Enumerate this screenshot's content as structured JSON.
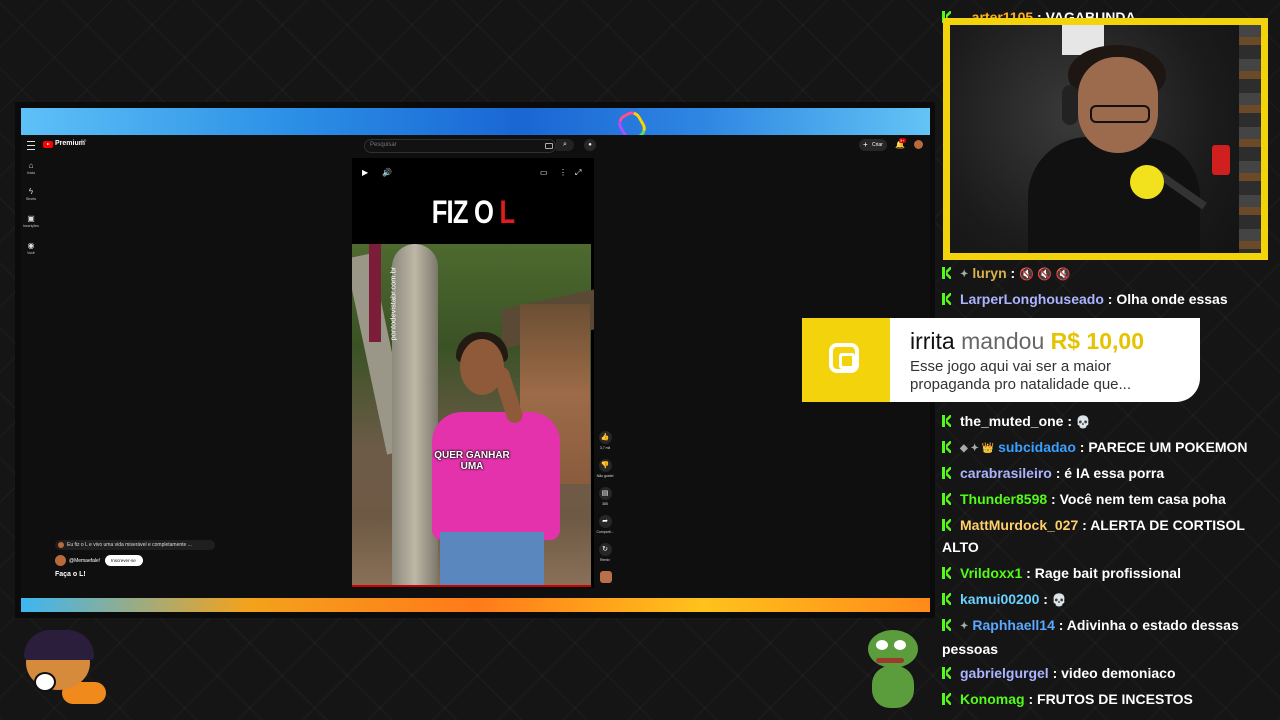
{
  "youtube": {
    "brand": "Premium",
    "country": "BR",
    "search_placeholder": "Pesquisar",
    "create_label": "Criar",
    "notification_count": "9+",
    "nav": [
      {
        "icon": "⌂",
        "label": "Início"
      },
      {
        "icon": "ϟ",
        "label": "Shorts"
      },
      {
        "icon": "▣",
        "label": "Inscrições"
      },
      {
        "icon": "◉",
        "label": "Você"
      }
    ],
    "short": {
      "headline_part1": "FIZ O ",
      "headline_part2": "L",
      "watermark": "pontodevistabr.com.br",
      "caption": "QUER GANHAR UMA",
      "title": "Faça o L!",
      "description": "Eu fiz o L e vivo uma vida miserável e completamente ...",
      "channel": "@Memaefale!",
      "subscribe_label": "Inscrever-se"
    },
    "actions": [
      {
        "icon": "👍",
        "label": "3,7 mil"
      },
      {
        "icon": "👎",
        "label": "Não gostei"
      },
      {
        "icon": "▤",
        "label": "385"
      },
      {
        "icon": "➦",
        "label": "Comparti..."
      },
      {
        "icon": "↻",
        "label": "Remix"
      }
    ]
  },
  "donation": {
    "user": "irrita",
    "verb": "mandou",
    "amount": "R$ 10,00",
    "message": "Esse jogo aqui vai ser a maior propaganda pro natalidade que..."
  },
  "chat": [
    {
      "user": "...arter1105",
      "text": "VAGABUNDA",
      "color": "#ffb020",
      "badges": "",
      "emotes": ""
    },
    {
      "user": "luryn",
      "text": "",
      "color": "#d8b14a",
      "badges": "✦",
      "emotes": "🔇 🔇 🔇"
    },
    {
      "user": "LarperLonghouseado",
      "text": "Olha onde essas",
      "color": "#aab4ff",
      "badges": "",
      "emotes": ""
    },
    {
      "user": "the_muted_one",
      "text": "",
      "color": "#ffffff",
      "badges": "",
      "emotes": "💀"
    },
    {
      "user": "subcidadao",
      "text": "PARECE UM POKEMON",
      "color": "#3aa0ff",
      "badges": "◆ ✦ 👑",
      "emotes": ""
    },
    {
      "user": "carabrasileiro",
      "text": "é IA essa porra",
      "color": "#aab4ff",
      "badges": "",
      "emotes": ""
    },
    {
      "user": "Thunder8598",
      "text": "Você nem tem casa poha",
      "color": "#53fc18",
      "badges": "",
      "emotes": ""
    },
    {
      "user": "MattMurdock_027",
      "text": "ALERTA DE CORTISOL ALTO",
      "color": "#ffcf6a",
      "badges": "",
      "emotes": ""
    },
    {
      "user": "Vrildoxx1",
      "text": "Rage bait profissional",
      "color": "#53fc18",
      "badges": "",
      "emotes": ""
    },
    {
      "user": "kamui00200",
      "text": "",
      "color": "#6ad0ff",
      "badges": "",
      "emotes": "💀"
    },
    {
      "user": "Raphhaell14",
      "text": "Adivinha o estado dessas pessoas",
      "color": "#5aa8ff",
      "badges": "✦",
      "emotes": ""
    },
    {
      "user": "gabrielgurgel",
      "text": "video demoniaco",
      "color": "#aab4ff",
      "badges": "",
      "emotes": ""
    },
    {
      "user": "Konomag",
      "text": "FRUTOS DE INCESTOS",
      "color": "#53fc18",
      "badges": "",
      "emotes": ""
    }
  ],
  "colors": {
    "kick_green": "#53fc18",
    "cam_border": "#f3d40c",
    "donation_amount": "#e5c300",
    "youtube_red": "#ff0000"
  }
}
